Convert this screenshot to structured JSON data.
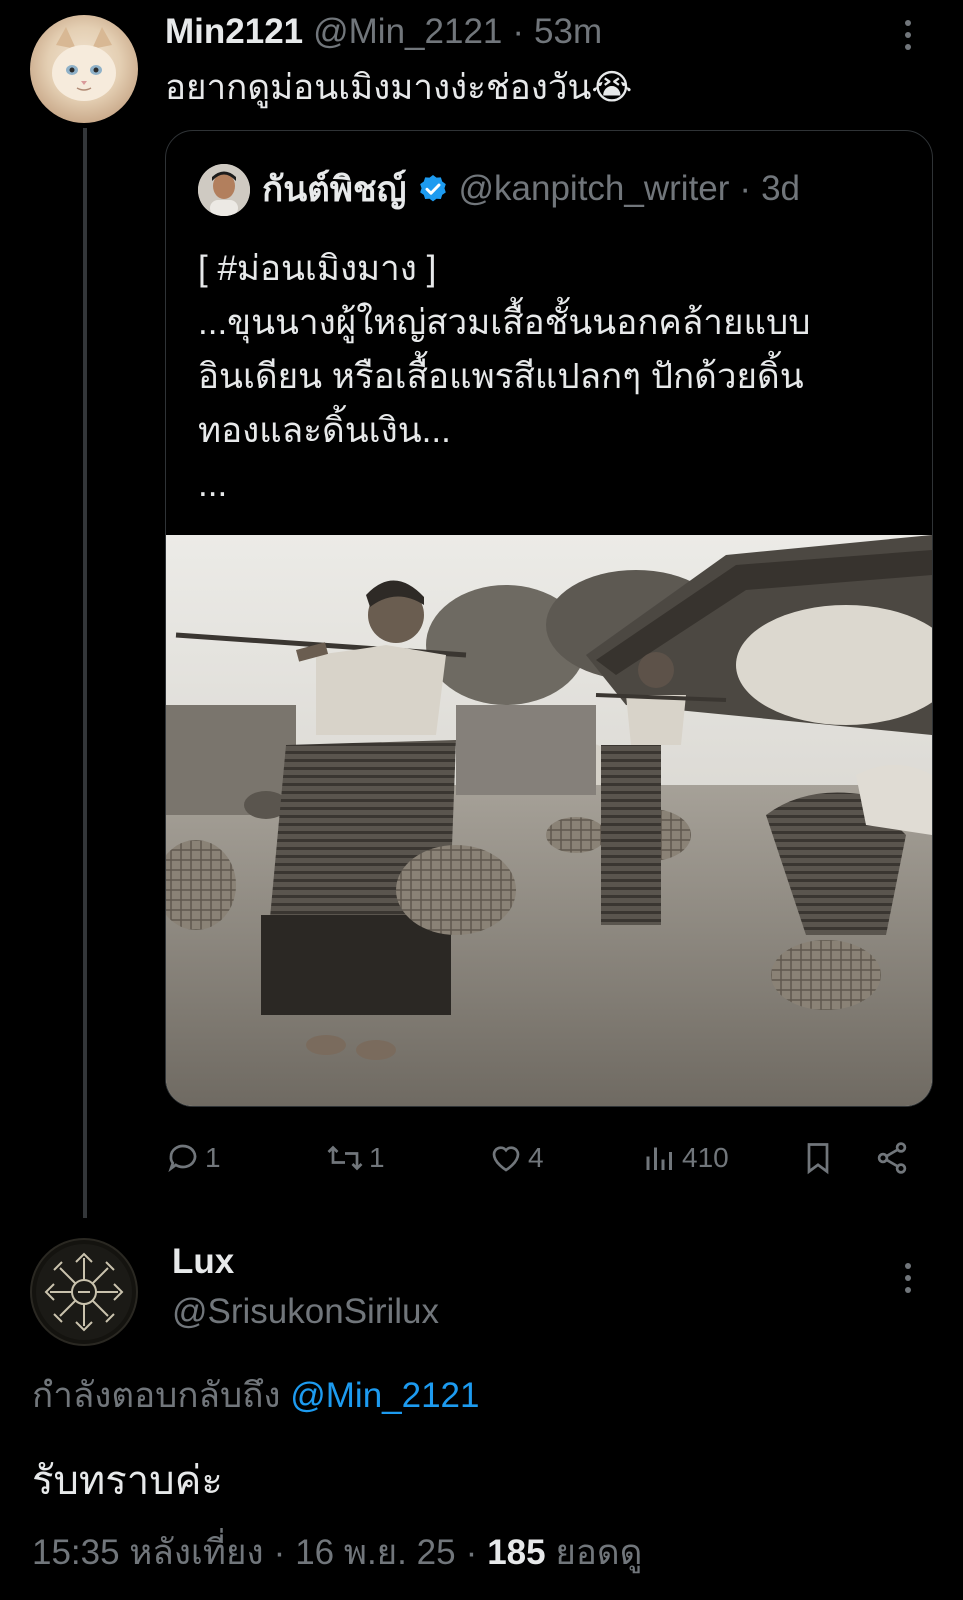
{
  "tweet": {
    "display_name": "Min2121",
    "handle": "@Min_2121",
    "separator": "·",
    "time": "53m",
    "text": "อยากดูม่อนเมิงมางง่ะช่องวัน😭"
  },
  "quoted": {
    "display_name": "กันต์พิชญ์",
    "handle": "@kanpitch_writer",
    "separator": "·",
    "time": "3d",
    "lines": [
      "[ #ม่อนเมิงมาง ]",
      "...ขุนนางผู้ใหญ่สวมเสื้อชั้นนอกคล้ายแบบ",
      "อินเดียน หรือเสื้อแพรสีแปลกๆ ปักด้วยดิ้น",
      "ทองและดิ้นเงิน...",
      "..."
    ]
  },
  "actions": {
    "replies": "1",
    "reposts": "1",
    "likes": "4",
    "views": "410"
  },
  "reply": {
    "display_name": "Lux",
    "handle": "@SrisukonSirilux",
    "replying_to_label": "กำลังตอบกลับถึง",
    "replying_to_handle": "@Min_2121",
    "text": "รับทราบค่ะ",
    "time": "15:35 หลังเที่ยง",
    "separator": "·",
    "date": "16 พ.ย. 25",
    "views_count": "185",
    "views_label": "ยอดดู"
  },
  "colors": {
    "background": "#000000",
    "text": "#e7e9ea",
    "muted": "#71767b",
    "accent": "#1d9bf0",
    "border": "#2f3336"
  },
  "icons": [
    "more-icon",
    "verified-badge-icon",
    "reply-icon",
    "repost-icon",
    "like-icon",
    "views-icon",
    "bookmark-icon",
    "share-icon"
  ]
}
